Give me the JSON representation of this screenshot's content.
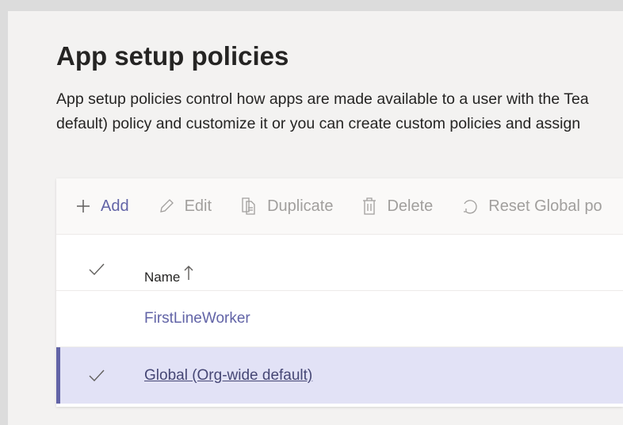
{
  "page": {
    "title": "App setup policies",
    "description": [
      "App setup policies control how apps are made available to a user with the Tea",
      "default) policy and customize it or you can create custom policies and assign"
    ]
  },
  "toolbar": {
    "add": "Add",
    "edit": "Edit",
    "duplicate": "Duplicate",
    "delete": "Delete",
    "reset": "Reset Global po"
  },
  "table": {
    "header": {
      "name": "Name",
      "sort": "ascending"
    },
    "rows": [
      {
        "name": "FirstLineWorker",
        "selected": false
      },
      {
        "name": "Global (Org-wide default)",
        "selected": true
      }
    ]
  },
  "colors": {
    "accent": "#6264a7",
    "selected_bg": "#e2e2f6"
  }
}
